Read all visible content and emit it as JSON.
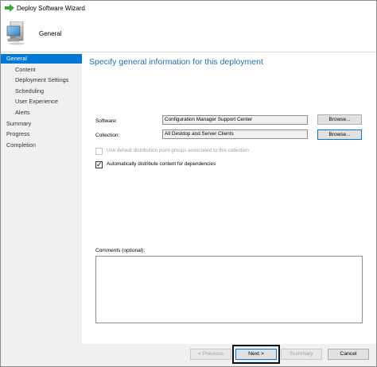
{
  "window": {
    "title": "Deploy Software Wizard"
  },
  "header": {
    "title": "General",
    "icon": "computer-icon"
  },
  "nav": {
    "items": [
      {
        "label": "General",
        "level": 0,
        "selected": true
      },
      {
        "label": "Content",
        "level": 1,
        "selected": false
      },
      {
        "label": "Deployment Settings",
        "level": 1,
        "selected": false
      },
      {
        "label": "Scheduling",
        "level": 1,
        "selected": false
      },
      {
        "label": "User Experience",
        "level": 1,
        "selected": false
      },
      {
        "label": "Alerts",
        "level": 1,
        "selected": false
      },
      {
        "label": "Summary",
        "level": 0,
        "selected": false
      },
      {
        "label": "Progress",
        "level": 0,
        "selected": false
      },
      {
        "label": "Completion",
        "level": 0,
        "selected": false
      }
    ]
  },
  "main": {
    "heading": "Specify general information for this deployment",
    "software": {
      "label": "Software:",
      "value": "Configuration Manager Support Center",
      "browse_label": "Browse..."
    },
    "collection": {
      "label": "Collection:",
      "value": "All Desktop and Server Clients",
      "browse_label": "Browse..."
    },
    "checkbox_default_groups": {
      "label": "Use default distribution point groups associated to this collection",
      "checked": false,
      "enabled": false
    },
    "checkbox_auto_distribute": {
      "label": "Automatically distribute content for dependencies",
      "checked": true,
      "enabled": true
    },
    "comments": {
      "label": "Comments (optional):",
      "value": ""
    }
  },
  "footer": {
    "previous_label": "< Previous",
    "next_label": "Next >",
    "summary_label": "Summary",
    "cancel_label": "Cancel"
  },
  "colors": {
    "accent": "#0078d7",
    "heading": "#1f6fb5",
    "nav_background": "#f0f0f0",
    "title_arrow": "#3aa935"
  }
}
